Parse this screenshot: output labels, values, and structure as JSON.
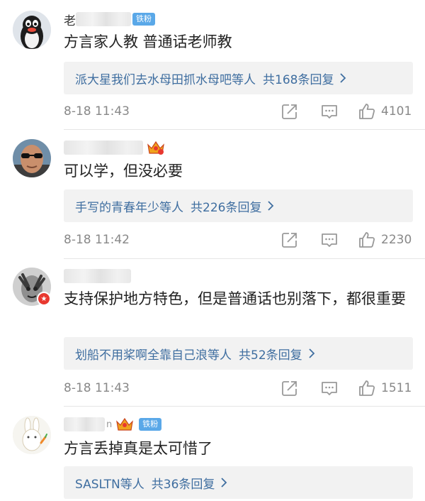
{
  "comments": [
    {
      "username_visible": "老",
      "fan_badge": "铁粉",
      "text": "方言家人教 普通话老师教",
      "reply_users": "派大星我们去水母田抓水母吧等人",
      "reply_count": "共168条回复",
      "time": "8-18 11:43",
      "likes": "4101",
      "avatar_icon": "penguin-avatar"
    },
    {
      "crown_badge": "vip-crown-icon",
      "text": "可以学，但没必要",
      "reply_users": "手写的青春年少等人",
      "reply_count": "共226条回复",
      "time": "8-18 11:42",
      "likes": "2230",
      "avatar_icon": "sunglasses-man-avatar"
    },
    {
      "text": "支持保护地方特色，但是普通话也别落下，都很重要",
      "reply_users": "划船不用桨啊全靠自己浪等人",
      "reply_count": "共52条回复",
      "time": "8-18 11:43",
      "likes": "1511",
      "avatar_icon": "hand-face-avatar"
    },
    {
      "username_visible": "n",
      "fan_badge": "铁粉",
      "crown_badge": "vip-crown-icon",
      "text": "方言丢掉真是太可惜了",
      "reply_users": "SASLTN等人",
      "reply_count": "共36条回复",
      "avatar_icon": "rabbit-avatar"
    }
  ],
  "icons": {
    "share": "share-icon",
    "comment": "comment-icon",
    "like": "thumbs-up-icon",
    "chevron": "chevron-right-icon"
  },
  "colors": {
    "link": "#3f6ea0",
    "fan_badge": "#5aa8e8",
    "crown": "#f0a31c",
    "reply_bg": "#f2f2f2",
    "meta_text": "#888888"
  }
}
